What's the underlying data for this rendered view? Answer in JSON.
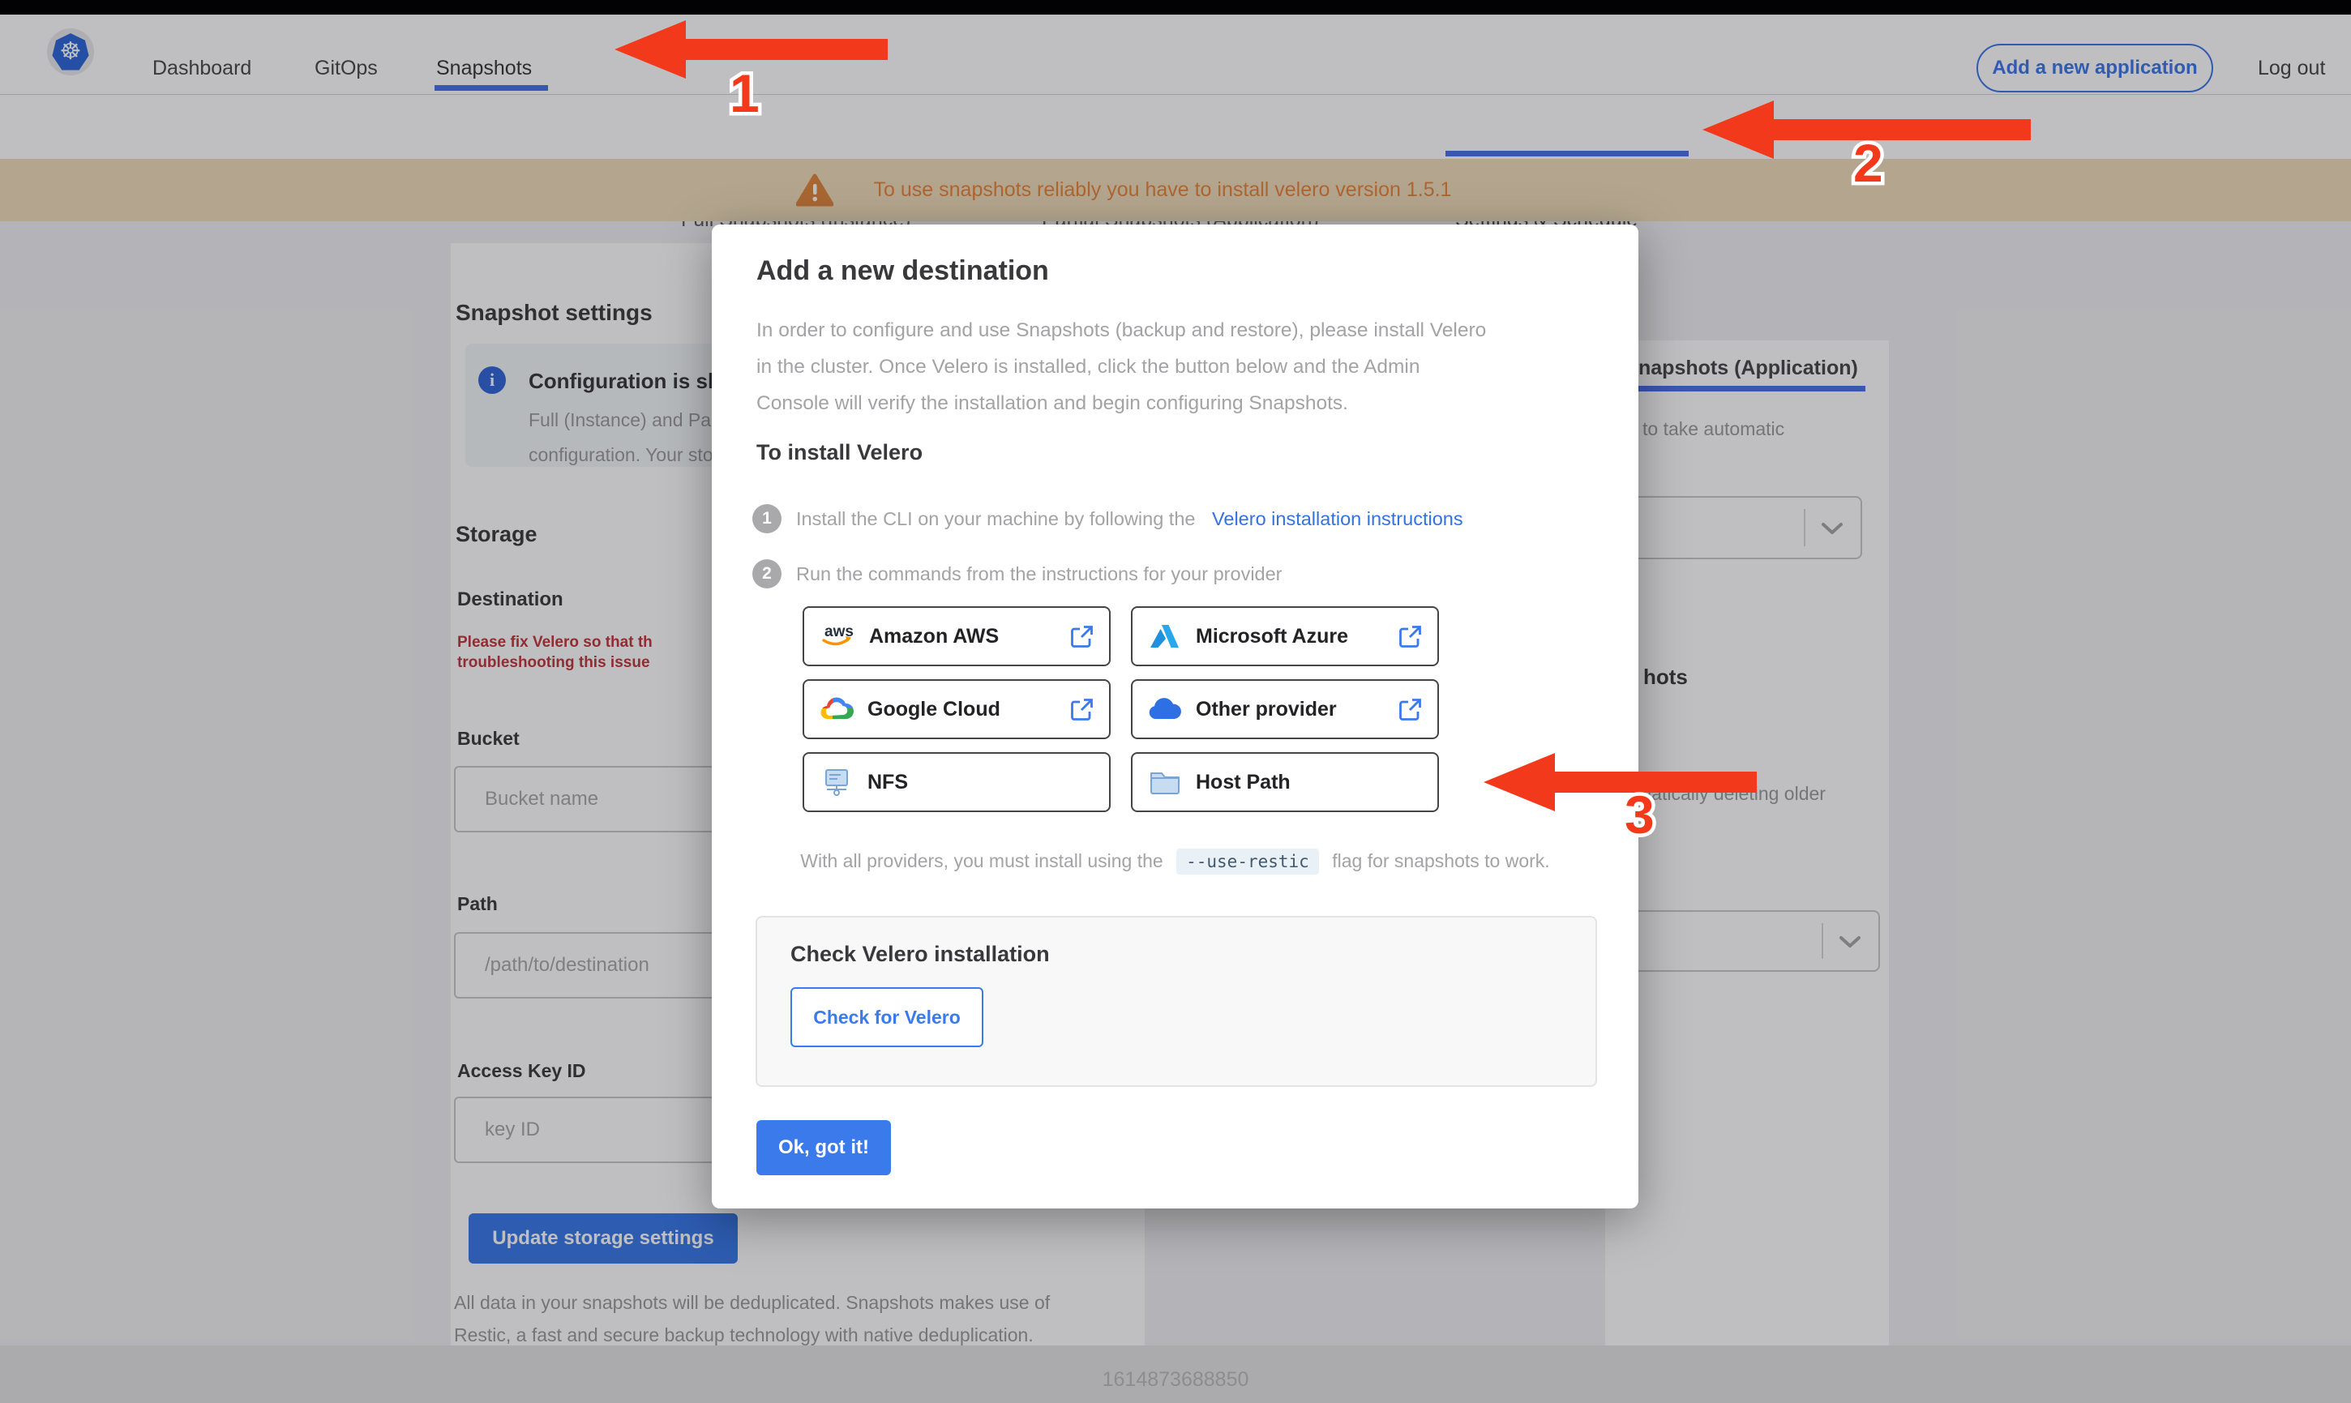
{
  "topnav": {
    "items": [
      {
        "label": "Dashboard"
      },
      {
        "label": "GitOps"
      },
      {
        "label": "Snapshots"
      }
    ],
    "active": "Snapshots",
    "add_app_label": "Add a new application",
    "logout_label": "Log out"
  },
  "tabs": {
    "items": [
      {
        "label": "Full Snapshots (Instance)"
      },
      {
        "label": "Partial Snapshots (Application)"
      },
      {
        "label": "Settings & Schedule"
      }
    ],
    "active": "Settings & Schedule"
  },
  "banner": {
    "text": "To use snapshots reliably you have to install velero version 1.5.1"
  },
  "settings_page": {
    "title": "Snapshot settings",
    "info_card": {
      "title_fragment": "Configuration is sh",
      "line1_fragment": "Full (Instance) and Parti",
      "line2_fragment": "configuration. Your stor"
    },
    "storage_heading": "Storage",
    "destination_heading": "Destination",
    "error_line1": "Please fix Velero so that th",
    "error_line2": "troubleshooting this issue",
    "bucket": {
      "label": "Bucket",
      "placeholder": "Bucket name"
    },
    "path": {
      "label": "Path",
      "placeholder": "/path/to/destination"
    },
    "access_key": {
      "label": "Access Key ID",
      "placeholder": "key ID"
    },
    "update_button": "Update storage settings",
    "dedup_line1": "All data in your snapshots will be deduplicated. Snapshots makes use of",
    "dedup_line2": "Restic, a fast and secure backup technology with native deduplication.",
    "schedule_column": {
      "tab_fragment": "napshots (Application)",
      "auto_fragment": "to take automatic",
      "retention_heading_fragment": "hots",
      "retention_fragment": "matically deleting older"
    }
  },
  "modal": {
    "title": "Add a new destination",
    "description": "In order to configure and use Snapshots (backup and restore), please install Velero in the cluster. Once Velero is installed, click the button below and the Admin Console will verify the installation and begin configuring Snapshots.",
    "install_heading": "To install Velero",
    "steps": [
      {
        "number": "1",
        "text": "Install the CLI on your machine by following the",
        "link_label": "Velero installation instructions"
      },
      {
        "number": "2",
        "text": "Run the commands from the instructions for your provider"
      }
    ],
    "providers": [
      {
        "label": "Amazon AWS",
        "icon": "aws-logo-icon",
        "has_external_link": true
      },
      {
        "label": "Microsoft Azure",
        "icon": "azure-logo-icon",
        "has_external_link": true
      },
      {
        "label": "Google Cloud",
        "icon": "google-cloud-logo-icon",
        "has_external_link": true
      },
      {
        "label": "Other provider",
        "icon": "cloud-icon",
        "has_external_link": true
      },
      {
        "label": "NFS",
        "icon": "nfs-drive-icon",
        "has_external_link": false
      },
      {
        "label": "Host Path",
        "icon": "folder-icon",
        "has_external_link": false
      }
    ],
    "restic_note": {
      "before": "With all providers, you must install using the",
      "code": "--use-restic",
      "after": "flag for snapshots to work."
    },
    "check_section": {
      "heading": "Check Velero installation",
      "button_label": "Check for Velero"
    },
    "ok_button": "Ok, got it!"
  },
  "footer": {
    "timestamp": "1614873688850"
  },
  "annotations": {
    "step1": "1",
    "step2": "2",
    "step3": "3"
  },
  "colors": {
    "accent_blue": "#3b7aea",
    "underline_blue": "#4a74e8",
    "warning_orange": "#e8873e",
    "banner_bg": "#f1ddba",
    "error_red": "#c03a40",
    "arrow_red": "#f2391c"
  }
}
